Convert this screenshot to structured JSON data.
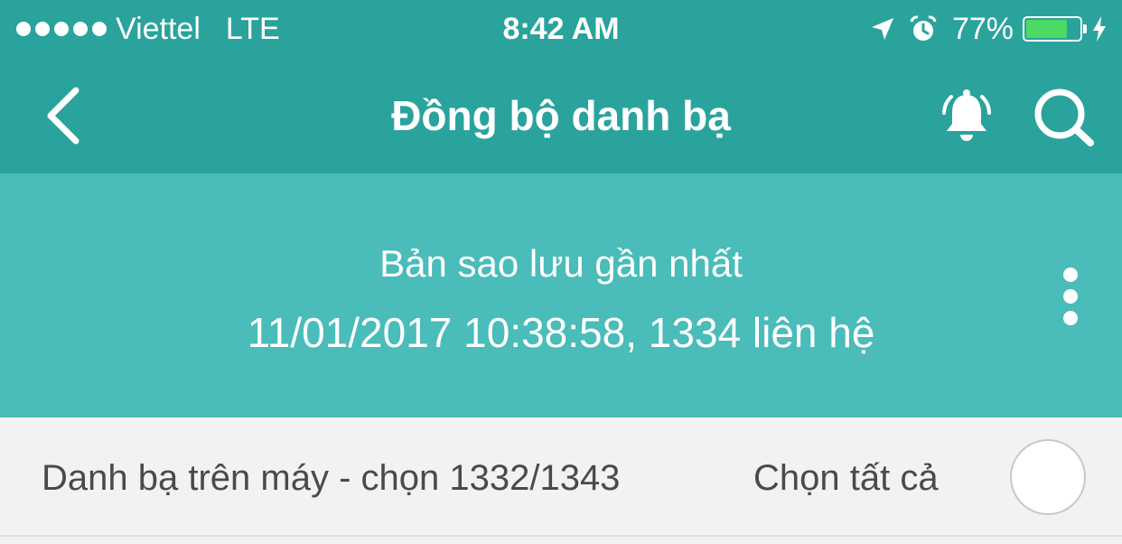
{
  "status_bar": {
    "carrier": "Viettel",
    "network": "LTE",
    "time": "8:42 AM",
    "battery_percent": "77%",
    "battery_level": 0.77,
    "battery_color": "#4cd964",
    "icons": [
      "signal-dots",
      "location-arrow-icon",
      "alarm-clock-icon",
      "battery-icon",
      "charging-bolt-icon"
    ]
  },
  "nav_bar": {
    "title": "Đồng bộ danh bạ",
    "icons": [
      "chevron-left-icon",
      "bell-ringing-icon",
      "search-icon"
    ],
    "background_color": "#2aa39d"
  },
  "backup": {
    "title": "Bản sao lưu gần nhất",
    "detail": "11/01/2017 10:38:58, 1334 liên hệ",
    "menu_icon": "more-vertical-icon",
    "background_color": "#4abcb9"
  },
  "selection": {
    "summary": "Danh bạ trên máy - chọn 1332/1343",
    "select_all_label": "Chọn tất cả",
    "select_all_checked": false
  }
}
